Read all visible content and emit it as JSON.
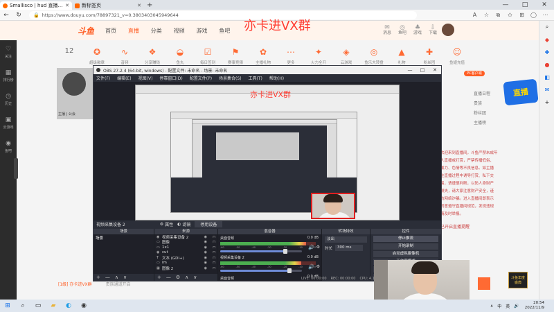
{
  "browser": {
    "tabs": [
      {
        "title": "Smallisco | hud 直播_热门游戏直播",
        "active": true
      },
      {
        "title": "新标签页",
        "active": false
      }
    ],
    "new_tab_symbol": "+",
    "url": "https://www.douyu.com/78897321_v=0.3803403045949644",
    "win_controls": [
      "—",
      "□",
      "✕"
    ]
  },
  "site": {
    "logo": "斗鱼",
    "nav": [
      "首页",
      "直播",
      "分类",
      "视频",
      "游戏",
      "鱼吧"
    ],
    "nav_active_index": 1,
    "header_icons": [
      {
        "label": "消息",
        "glyph": "✉"
      },
      {
        "label": "鱼吧",
        "glyph": "◎"
      },
      {
        "label": "游戏",
        "glyph": "♣"
      },
      {
        "label": "下载",
        "glyph": "⇩"
      },
      {
        "label": "开播",
        "glyph": "◈"
      }
    ],
    "watermark": "亦卡进VX群",
    "left_rail": [
      {
        "label": "关注",
        "glyph": "♡"
      },
      {
        "label": "排行榜",
        "glyph": "▦"
      },
      {
        "label": "历史",
        "glyph": "◷"
      },
      {
        "label": "云游戏",
        "glyph": "▣"
      },
      {
        "label": "鱼吧",
        "glyph": "◉"
      }
    ],
    "toolbar": [
      {
        "label": "12",
        "glyph": "12"
      },
      {
        "label": "超级徽章",
        "glyph": "✪"
      },
      {
        "label": "音频",
        "glyph": "∿"
      },
      {
        "label": "分享赚钱",
        "glyph": "❖"
      },
      {
        "label": "鱼丸",
        "glyph": "◒"
      },
      {
        "label": "每日签到",
        "glyph": "☑"
      },
      {
        "label": "赛事竞猜",
        "glyph": "⚑"
      },
      {
        "label": "主播礼物",
        "glyph": "✿"
      },
      {
        "label": "更多",
        "glyph": "⋯"
      },
      {
        "label": "火力全开",
        "glyph": "✦"
      },
      {
        "label": "云游戏",
        "glyph": "◈"
      },
      {
        "label": "鱼乐大转盘",
        "glyph": "◎"
      },
      {
        "label": "礼物",
        "glyph": "▲"
      },
      {
        "label": "粉丝团",
        "glyph": "✚"
      },
      {
        "label": "鱼翅充值",
        "glyph": "☺"
      }
    ],
    "right_badge": "PC客户端",
    "right_links": [
      "直播日程",
      "贵族",
      "粉丝团",
      "主播榜"
    ],
    "right_lines": [
      "欢迎来到直播间，斗鱼严禁未成年",
      "人直播或打赏，严禁传播低俗、",
      "暴力、色情等不良信息。如主播",
      "在直播过程中诱导打赏、私下交",
      "易，请谨慎判断，以防人身财产",
      "损失，请大家注意财产安全，谨",
      "防网络诈骗。进入直播间即表示",
      "同意遵守直播间规范，发现违规",
      "请及时举报。"
    ],
    "right_footer": "已开启直播提醒",
    "streamer_caption": "主播 | 公会",
    "footer_left": "[1级] 亦卡进VX群",
    "footer_tag": "贵族通道开启",
    "side_logo": "直播",
    "side_logo2": "斗鱼年度 盛典"
  },
  "obs": {
    "title": "OBS 27.2.4 (64-bit, windows) - 配置文件: 未命名 - 场景: 未命名",
    "menus": [
      "文件(F)",
      "编辑(E)",
      "视图(V)",
      "停靠窗口(D)",
      "配置文件(P)",
      "场景集合(S)",
      "工具(T)",
      "帮助(H)"
    ],
    "inner_watermark": "亦卡进VX群",
    "source_bar": {
      "selected": "视频采集设备 2",
      "properties": "属性",
      "filters": "滤镜",
      "deactivate": "停用设备"
    },
    "docks": {
      "scenes": {
        "title": "场景",
        "items": [
          "场景"
        ]
      },
      "sources": {
        "title": "来源",
        "items": [
          {
            "type": "cam",
            "glyph": "◉",
            "name": "视频采集设备 2"
          },
          {
            "type": "img",
            "glyph": "▭",
            "name": "图像"
          },
          {
            "type": "img",
            "glyph": "▭",
            "name": "1x1"
          },
          {
            "type": "img",
            "glyph": "◉",
            "name": "cut"
          },
          {
            "type": "txt",
            "glyph": "T",
            "name": "文本 (GDI+)"
          },
          {
            "type": "img",
            "glyph": "▭",
            "name": "im"
          },
          {
            "type": "cap",
            "glyph": "▦",
            "name": "图像 2"
          }
        ]
      },
      "mixer": {
        "title": "混音器",
        "channels": [
          {
            "name": "桌面音频",
            "db": "0.0 dB",
            "level": 0.9,
            "volume": 0.8
          },
          {
            "name": "视频采集设备 2",
            "db": "0.0 dB",
            "level": 0.85,
            "volume": 0.85
          },
          {
            "name": "桌面音频",
            "db": "0.0 dB",
            "level": 0.0,
            "volume": 0.0
          }
        ],
        "scale": [
          "-60",
          "-50",
          "-40",
          "-30",
          "-20",
          "-10",
          "0"
        ]
      },
      "transitions": {
        "title": "转场特效",
        "type": "淡出",
        "duration_label": "时长",
        "duration_value": "300 ms"
      },
      "controls": {
        "title": "控件",
        "buttons": [
          "停止推流",
          "开始录制",
          "启动虚拟摄像机",
          "工作室模式",
          "设置",
          "退出"
        ]
      }
    },
    "status": [
      "LIVE: 00:00:00",
      "REC: 00:00:00",
      "CPU: 4.1%, 30.00 fps"
    ],
    "dock_footer": [
      "+",
      "—",
      "∧",
      "∨"
    ]
  },
  "taskbar": {
    "tray": [
      "∧",
      "中",
      "英",
      "🔊"
    ],
    "time": "20:54",
    "date": "2022/11/9"
  },
  "colors": {
    "brand": "#ff5d23",
    "obs_bg": "#2b2e38",
    "webcam_border": "#e02020"
  }
}
